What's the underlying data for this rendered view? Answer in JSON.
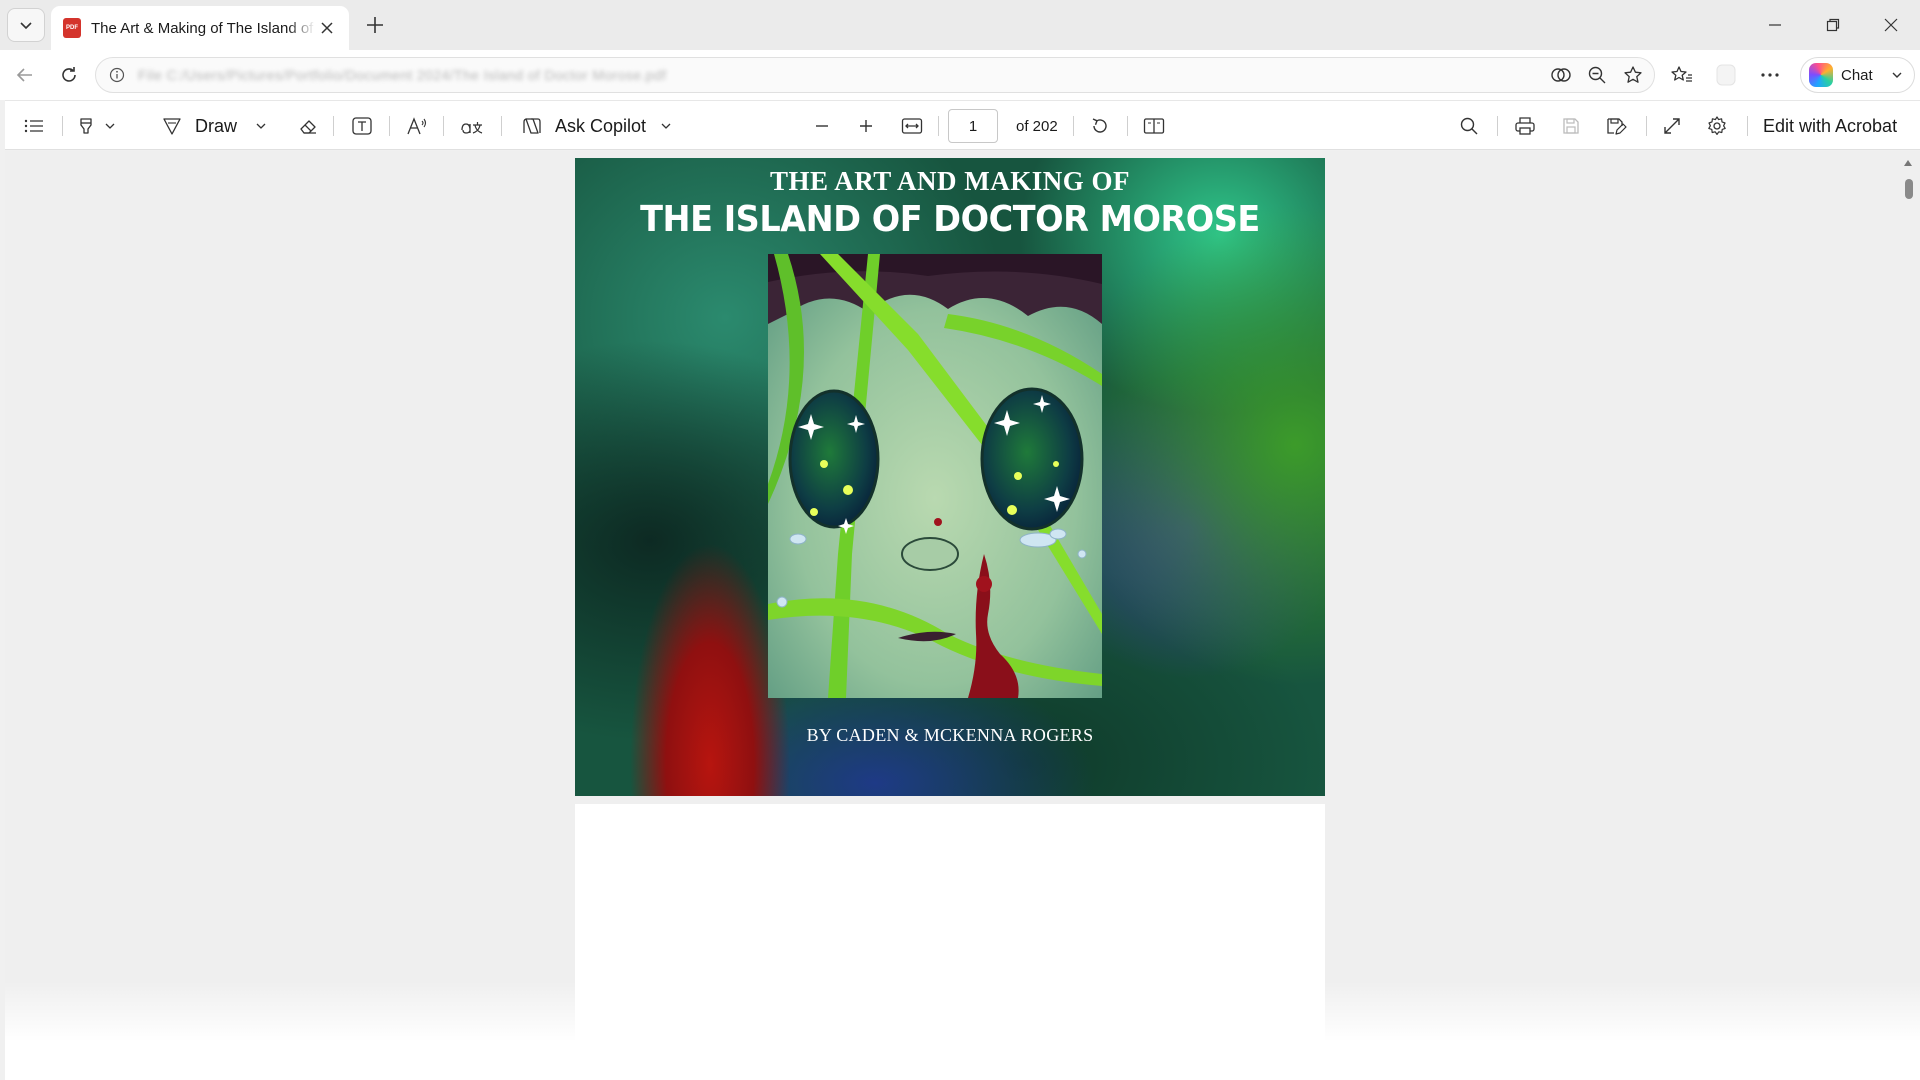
{
  "browser": {
    "tab": {
      "title": "The Art & Making of The Island of Doctor Morose",
      "favicon_label": "PDF"
    },
    "address_bar": {
      "url": "File C:/Users/Pictures/Portfolio/Document 2024/The Island of Doctor Morose.pdf"
    },
    "chat_label": "Chat"
  },
  "pdf_toolbar": {
    "draw_label": "Draw",
    "ask_copilot_label": "Ask Copilot",
    "current_page": "1",
    "page_count_label": "of 202",
    "edit_acrobat_label": "Edit with Acrobat"
  },
  "document": {
    "cover": {
      "title_line1": "THE ART AND MAKING OF",
      "title_line2": "THE ISLAND OF DOCTOR MOROSE",
      "author": "BY CADEN & MCKENNA ROGERS"
    }
  },
  "colors": {
    "cover_background": "#17553f",
    "tab_strip": "#ebebeb",
    "pdf_icon_red": "#d4342c"
  },
  "icons": [
    "tab-list-chevron-icon",
    "pdf-file-icon",
    "close-icon",
    "plus-icon",
    "minimize-icon",
    "restore-icon",
    "window-close-icon",
    "back-arrow-icon",
    "refresh-icon",
    "info-icon",
    "reader-icon",
    "zoom-icon",
    "star-icon",
    "favorites-icon",
    "profile-icon",
    "more-icon",
    "contents-icon",
    "highlight-icon",
    "draw-icon",
    "eraser-icon",
    "text-box-icon",
    "read-aloud-icon",
    "translate-icon",
    "copilot-icon",
    "zoom-out-icon",
    "zoom-in-icon",
    "fit-width-icon",
    "rotate-icon",
    "page-view-icon",
    "search-icon",
    "print-icon",
    "save-icon",
    "save-as-icon",
    "fullscreen-icon",
    "settings-icon"
  ]
}
